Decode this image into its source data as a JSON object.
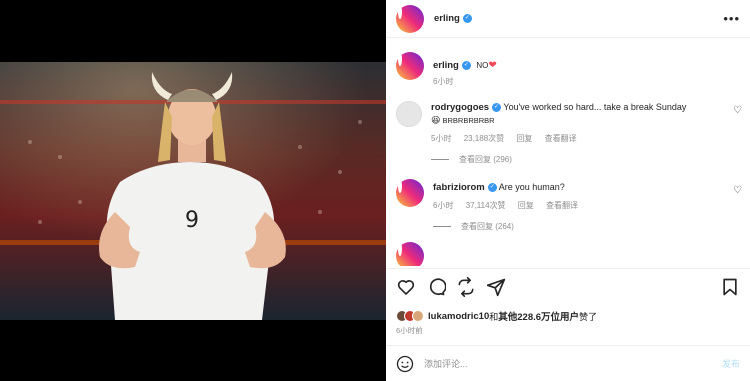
{
  "post": {
    "author": "erling",
    "time": "6小时"
  },
  "caption": {
    "username": "erling",
    "text": "NO",
    "emoji": "❤",
    "time": "6小时"
  },
  "comments": [
    {
      "username": "rodrygogoes",
      "text": "You've worked so hard... take a break Sunday",
      "text2": "BRBRBRBRBR",
      "time": "5小时",
      "likes": "23,188次赞",
      "reply": "回复",
      "translate": "查看翻译",
      "view_replies": "查看回复 (296)"
    },
    {
      "username": "fabriziorom",
      "text": "Are you human?",
      "time": "6小时",
      "likes": "37,114次赞",
      "reply": "回复",
      "translate": "查看翻译",
      "view_replies": "查看回复 (264)"
    }
  ],
  "likes": {
    "prefix": "lukamodric10",
    "mid": "和",
    "others": "其他228.6万位用户",
    "suffix": "赞了"
  },
  "post_time": "6小时前",
  "composer": {
    "placeholder": "添加评论...",
    "post_label": "发布"
  },
  "colors": {
    "verified": "#3897f0",
    "heart": "#ed4956",
    "post_button": "#b2dffc"
  },
  "icons": [
    "heart-icon",
    "comment-icon",
    "share-icon",
    "send-icon",
    "save-icon",
    "emoji-icon",
    "more-icon"
  ]
}
